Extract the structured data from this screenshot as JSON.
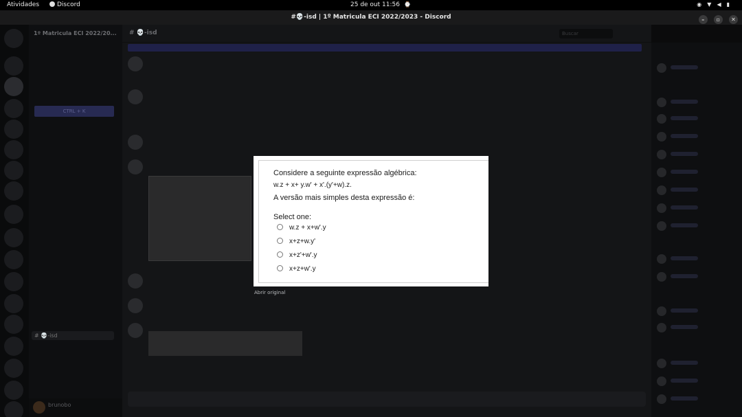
{
  "system_bar": {
    "activities": "Atividades",
    "app_name": "Discord",
    "clock": "25 de out  11:56"
  },
  "window": {
    "title": "#💀-isd | 1º Matricula ECI 2022/2023 - Discord",
    "buttons": [
      "–",
      "▫",
      "✕"
    ]
  },
  "server": {
    "name": "1º Matricula ECI 2022/20...",
    "quick_switcher_button": "CTRL + K",
    "active_channel": "💀-isd",
    "user_name": "brunobo"
  },
  "chat_header": {
    "channel": "💀-isd",
    "search_placeholder": "Buscar"
  },
  "viewer": {
    "question_intro": "Considere a seguinte expressão algébrica:",
    "expression": "w.z + x+ y.w' + x'.(y'+w).z.",
    "question_prompt": "A versão mais simples desta expressão é:",
    "select_label": "Select one:",
    "options": [
      "w.z + x+w'.y",
      "x+z+w.y'",
      "x+z'+w'.y",
      "x+z+w'.y"
    ],
    "open_original": "Abrir original"
  }
}
